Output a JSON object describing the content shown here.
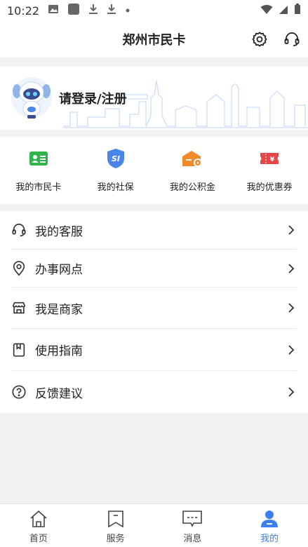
{
  "status_bar": {
    "time": "10:22"
  },
  "header": {
    "title": "郑州市民卡"
  },
  "profile": {
    "login_text": "请登录/注册"
  },
  "quick_actions": [
    {
      "label": "我的市民卡",
      "icon": "citizen-card-icon",
      "color": "#2fb34a"
    },
    {
      "label": "我的社保",
      "icon": "social-security-icon",
      "color": "#4a86e8"
    },
    {
      "label": "我的公积金",
      "icon": "provident-fund-icon",
      "color": "#f08a2a"
    },
    {
      "label": "我的优惠券",
      "icon": "coupon-icon",
      "color": "#e64646"
    }
  ],
  "menu": [
    {
      "label": "我的客服",
      "icon": "headset-icon"
    },
    {
      "label": "办事网点",
      "icon": "location-pin-icon"
    },
    {
      "label": "我是商家",
      "icon": "store-icon"
    },
    {
      "label": "使用指南",
      "icon": "guide-book-icon"
    },
    {
      "label": "反馈建议",
      "icon": "question-circle-icon"
    }
  ],
  "tabs": [
    {
      "label": "首页",
      "icon": "home-icon"
    },
    {
      "label": "服务",
      "icon": "bookmark-icon"
    },
    {
      "label": "消息",
      "icon": "message-icon"
    },
    {
      "label": "我的",
      "icon": "user-icon",
      "active": true
    }
  ],
  "colors": {
    "accent": "#3b7ff0",
    "background": "#f2f2f2"
  }
}
